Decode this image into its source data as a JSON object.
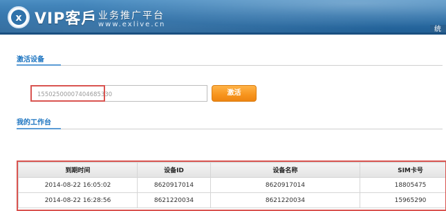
{
  "header": {
    "brand": "VIP客戶",
    "slogan": "业务推广平台",
    "site": "www.exlive.cn",
    "nav_tab": "统"
  },
  "activate_section": {
    "title": "激活设备",
    "input_value": "15502500007404685330",
    "button_label": "激活"
  },
  "workspace_section": {
    "title": "我的工作台"
  },
  "table": {
    "columns": [
      "到期时间",
      "设备ID",
      "设备名称",
      "SIM卡号"
    ],
    "rows": [
      [
        "2014-08-22 16:05:02",
        "8620917014",
        "8620917014",
        "18805475"
      ],
      [
        "2014-08-22 16:28:56",
        "8621220034",
        "8621220034",
        "15965290"
      ]
    ]
  },
  "colors": {
    "header_blue": "#2f72aa",
    "section_title": "#1a73c0",
    "button_orange": "#f7941d",
    "highlight_red": "#d9534f"
  }
}
